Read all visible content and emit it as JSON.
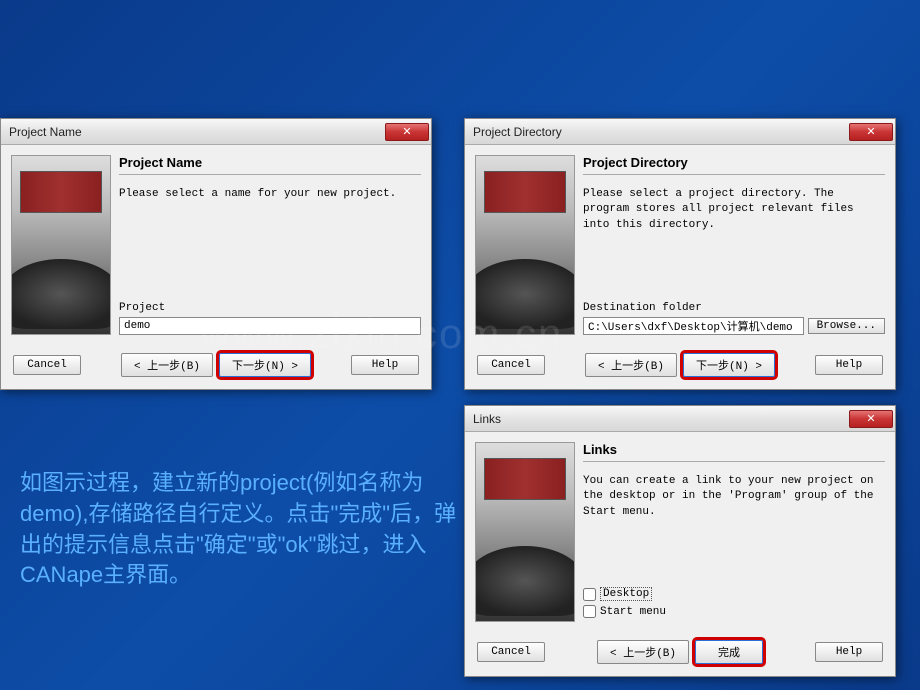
{
  "watermark": "www.zixin.com.cn",
  "dialog1": {
    "title": "Project Name",
    "heading": "Project Name",
    "description": "Please select a name for your new project.",
    "field_label": "Project",
    "field_value": "demo",
    "buttons": {
      "cancel": "Cancel",
      "back": "< 上一步(B)",
      "next": "下一步(N) >",
      "help": "Help"
    }
  },
  "dialog2": {
    "title": "Project Directory",
    "heading": "Project Directory",
    "description": "Please select a project directory. The program stores all project relevant files into this directory.",
    "field_label": "Destination folder",
    "field_value": "C:\\Users\\dxf\\Desktop\\计算机\\demo",
    "browse_label": "Browse...",
    "buttons": {
      "cancel": "Cancel",
      "back": "< 上一步(B)",
      "next": "下一步(N) >",
      "help": "Help"
    }
  },
  "dialog3": {
    "title": "Links",
    "heading": "Links",
    "description": "You can create a link to your new project on the desktop or in the 'Program' group of the Start menu.",
    "checkbox_desktop": "Desktop",
    "checkbox_startmenu": "Start menu",
    "buttons": {
      "cancel": "Cancel",
      "back": "< 上一步(B)",
      "finish": "完成",
      "help": "Help"
    }
  },
  "instruction": "如图示过程，建立新的project(例如名称为demo),存储路径自行定义。点击\"完成\"后，弹出的提示信息点击\"确定\"或\"ok\"跳过，进入CANape主界面。",
  "close_glyph": "✕"
}
